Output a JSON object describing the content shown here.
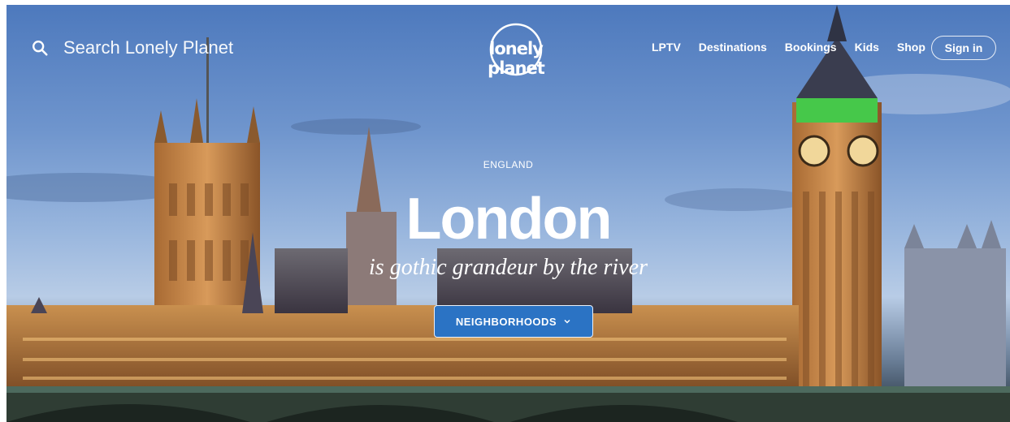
{
  "search": {
    "placeholder": "Search Lonely Planet",
    "icon": "search-icon"
  },
  "brand": {
    "logo_text": "lonely planet"
  },
  "nav": {
    "items": [
      {
        "label": "LPTV"
      },
      {
        "label": "Destinations"
      },
      {
        "label": "Bookings"
      },
      {
        "label": "Kids"
      },
      {
        "label": "Shop"
      }
    ],
    "sign_in": "Sign in"
  },
  "hero": {
    "eyebrow": "ENGLAND",
    "title": "London",
    "tagline": "is gothic grandeur by the river",
    "button": {
      "label": "NEIGHBORHOODS",
      "icon": "chevron-down-icon"
    }
  },
  "colors": {
    "button": "#2b73c4",
    "text": "#ffffff"
  }
}
